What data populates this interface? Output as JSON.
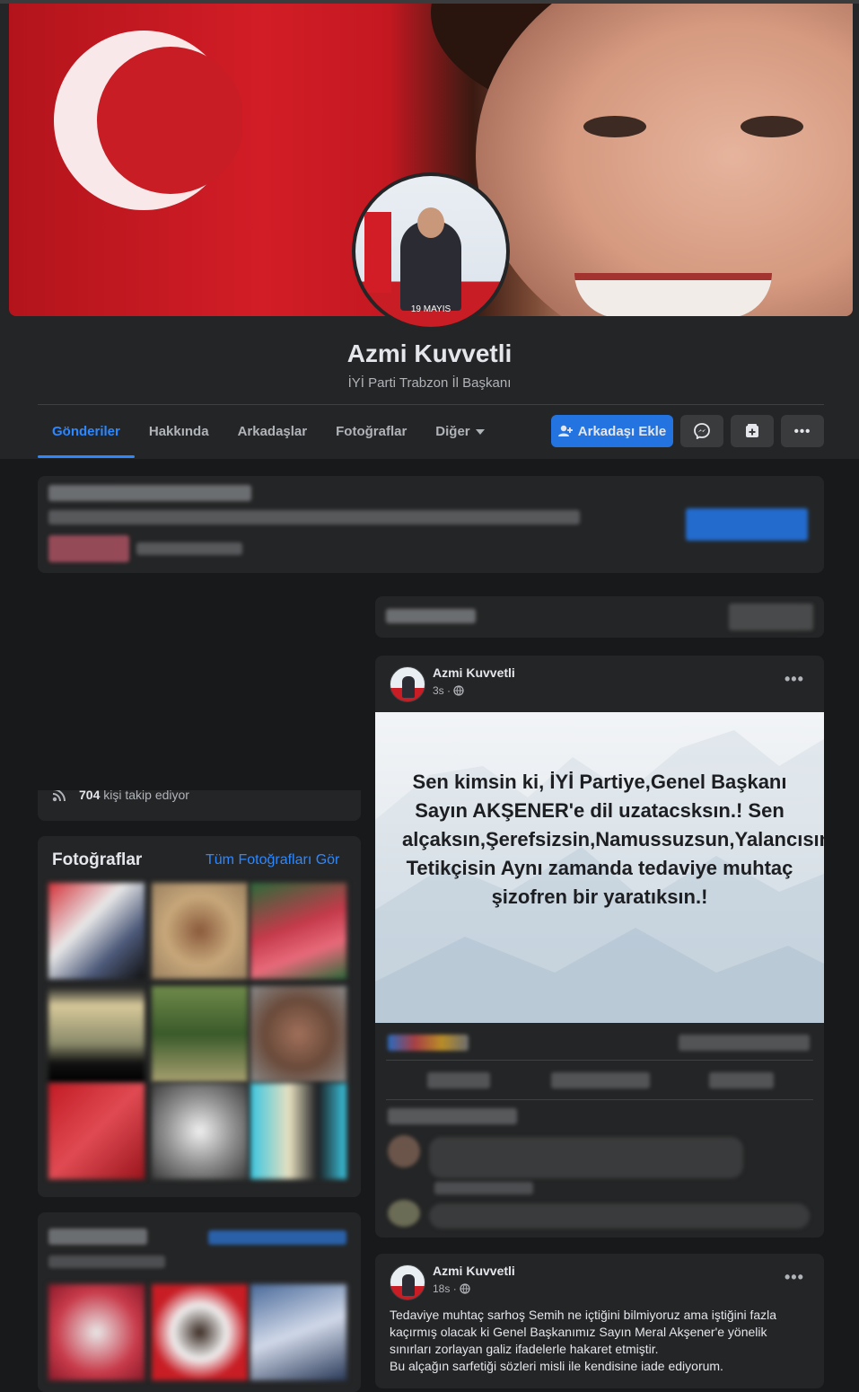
{
  "profile": {
    "name": "Azmi Kuvvetli",
    "bio": "İYİ Parti Trabzon İl Başkanı",
    "avatar_caption": "19 MAYIS"
  },
  "tabs": [
    {
      "label": "Gönderiler",
      "active": true
    },
    {
      "label": "Hakkında"
    },
    {
      "label": "Arkadaşlar"
    },
    {
      "label": "Fotoğraflar"
    },
    {
      "label": "Diğer"
    }
  ],
  "actions": {
    "add_friend": "Arkadaşı Ekle",
    "messenger_icon": "messenger-icon",
    "follow_icon": "follow-icon",
    "more_icon": "more-dots-icon"
  },
  "intro": {
    "followers_count": "704",
    "followers_text": "kişi takip ediyor"
  },
  "photos": {
    "title": "Fotoğraflar",
    "see_all": "Tüm Fotoğrafları Gör"
  },
  "posts": [
    {
      "author": "Azmi Kuvvetli",
      "time": "3s",
      "privacy_icon": "globe-icon",
      "quote": "Sen kimsin ki, İYİ Partiye,Genel Başkanı Sayın AKŞENER'e dil uzatacsksın.! Sen alçaksın,Şerefsizsin,Namussuzsun,Yalancısın Tetikçisin Aynı zamanda tedaviye muhtaç şizofren bir yaratıksın.!"
    },
    {
      "author": "Azmi Kuvvetli",
      "time": "18s",
      "privacy_icon": "globe-icon",
      "text_lines": [
        "Tedaviye muhtaç sarhoş Semih ne içtiğini bilmiyoruz ama iştiğini fazla",
        "kaçırmış olacak ki  Genel Başkanımız Sayın Meral Akşener'e yönelik",
        "sınırları zorlayan galiz ifadelerle hakaret etmiştir.",
        "Bu alçağın sarfetiği sözleri misli ile kendisine iade ediyorum."
      ]
    }
  ],
  "colors": {
    "background": "#18191a",
    "surface": "#242526",
    "accent": "#2d88ff",
    "primary_button": "#2374e1"
  }
}
